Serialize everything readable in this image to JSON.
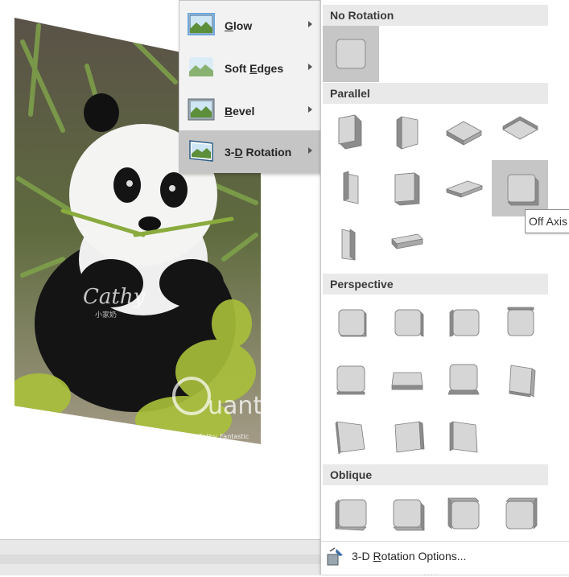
{
  "colors": {
    "menu_bg": "#f2f2f2",
    "menu_active": "#c5c5c5",
    "header_bg": "#e9e9e9",
    "shape_face": "#d6d6d6",
    "shape_side": "#8c8c8c"
  },
  "picture": {
    "subject": "panda-photo",
    "watermark_text": "Cathy",
    "watermark_sub": "小家奶",
    "credit_text": "@Cathy_Fantastic",
    "site_watermark": "uantrimang"
  },
  "effects_menu": {
    "items": [
      {
        "name": "glow",
        "label_pre": "",
        "label_key": "G",
        "label_post": "low",
        "icon": "glow-effect-icon"
      },
      {
        "name": "soft-edges",
        "label_pre": "Soft ",
        "label_key": "E",
        "label_post": "dges",
        "icon": "soft-edges-effect-icon"
      },
      {
        "name": "bevel",
        "label_pre": "",
        "label_key": "B",
        "label_post": "evel",
        "icon": "bevel-effect-icon"
      },
      {
        "name": "3d-rotation",
        "label_pre": "3-",
        "label_key": "D",
        "label_post": " Rotation",
        "icon": "3d-rotation-effect-icon",
        "active": true
      }
    ]
  },
  "gallery": {
    "sections": [
      {
        "title": "No Rotation",
        "count": 1
      },
      {
        "title": "Parallel",
        "count": 10
      },
      {
        "title": "Perspective",
        "count": 11
      },
      {
        "title": "Oblique",
        "count": 4
      }
    ],
    "tooltip": "Off Axis",
    "options_label_pre": "3-D ",
    "options_label_key": "R",
    "options_label_post": "otation Options...",
    "options_icon": "3d-rotation-options-icon",
    "grip": "....",
    "selected": "parallel-8"
  }
}
